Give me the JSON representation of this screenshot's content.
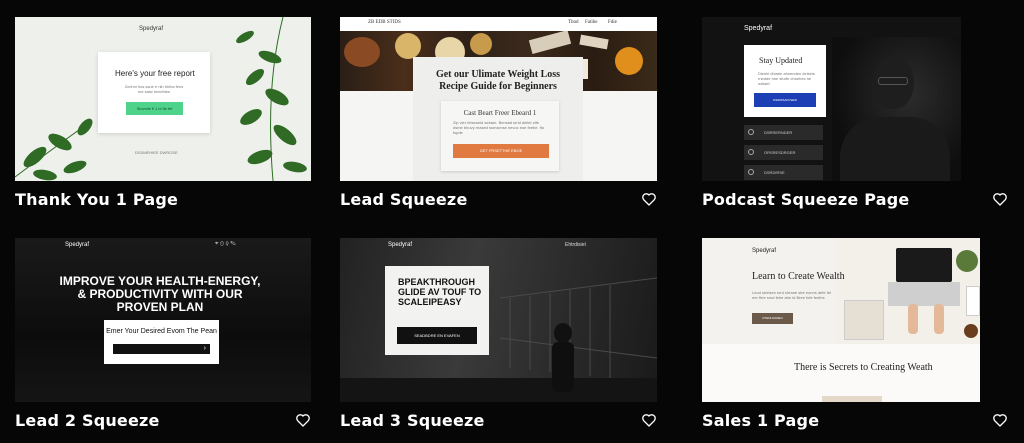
{
  "cards": [
    {
      "title": "Thank You 1 Page",
      "preview": {
        "brand": "Spedyraf",
        "heading": "Here's your free report",
        "body": "Zechni hos ssuir e nih hhiha fens rne saiw hrecthlen",
        "button": "Stovelie fi 1 bi fle fet",
        "footer": "DSSMEHIEE DWROSE"
      }
    },
    {
      "title": "Lead Squeeze",
      "preview": {
        "brand": "ZB EDB STIDS",
        "nav": [
          "Tbnd",
          "Fatibe",
          "Fdie"
        ],
        "heading": "Get our Ulimate Weight Loss Recipe Guide for Beginners",
        "form_title": "Cast Beart Freer Ebeard 1",
        "body": "Zip vier felseanid sebaer. Bensiat srrid deliet ctfe dsme bhuvy reased ssnvsmse nevoc eoe feebe. fto fspde",
        "button": "GET FRSETTHE EBOE"
      }
    },
    {
      "title": "Podcast Squeeze Page",
      "preview": {
        "brand": "Spedyraf",
        "heading": "Stay Updated",
        "body": "Dieshi dhiarle ahnenden deiseis rnedde nne sfurfe chnehes ne nsliaet",
        "button": "DSRIRSAFFSEW",
        "links": [
          "DSRRERNDER",
          "ORSRESDRGER",
          "DSRDIRSE"
        ]
      }
    },
    {
      "title": "Lead 2 Squeeze",
      "preview": {
        "brand": "Spedyraf",
        "heading": "IMPROVE YOUR HEALTH-ENERGY, & PRODUCTIVITY WITH OUR PROVEN PLAN",
        "form_label": "Emer Your Desired Evom The Pean"
      }
    },
    {
      "title": "Lead 3 Squeeze",
      "preview": {
        "brand": "Spedyraf",
        "nav": "Ehtrdisiet",
        "heading": "BPEAKTHROUGH GLIDE AV TOUF TO SCALEIPEASY",
        "button": "SEADBDRE EN EVAFEN"
      }
    },
    {
      "title": "Sales 1 Page",
      "preview": {
        "brand": "Spedyraf",
        "heading": "Learn to Create Wealth",
        "body": "Leod shelsee srrd shrane sbe eonns defe fel ner fhre srsd fehe ahe ld Bree fofe feelhe",
        "button": "NTENLNADEO",
        "subheading": "There is Secrets to Creating Weath"
      }
    }
  ]
}
